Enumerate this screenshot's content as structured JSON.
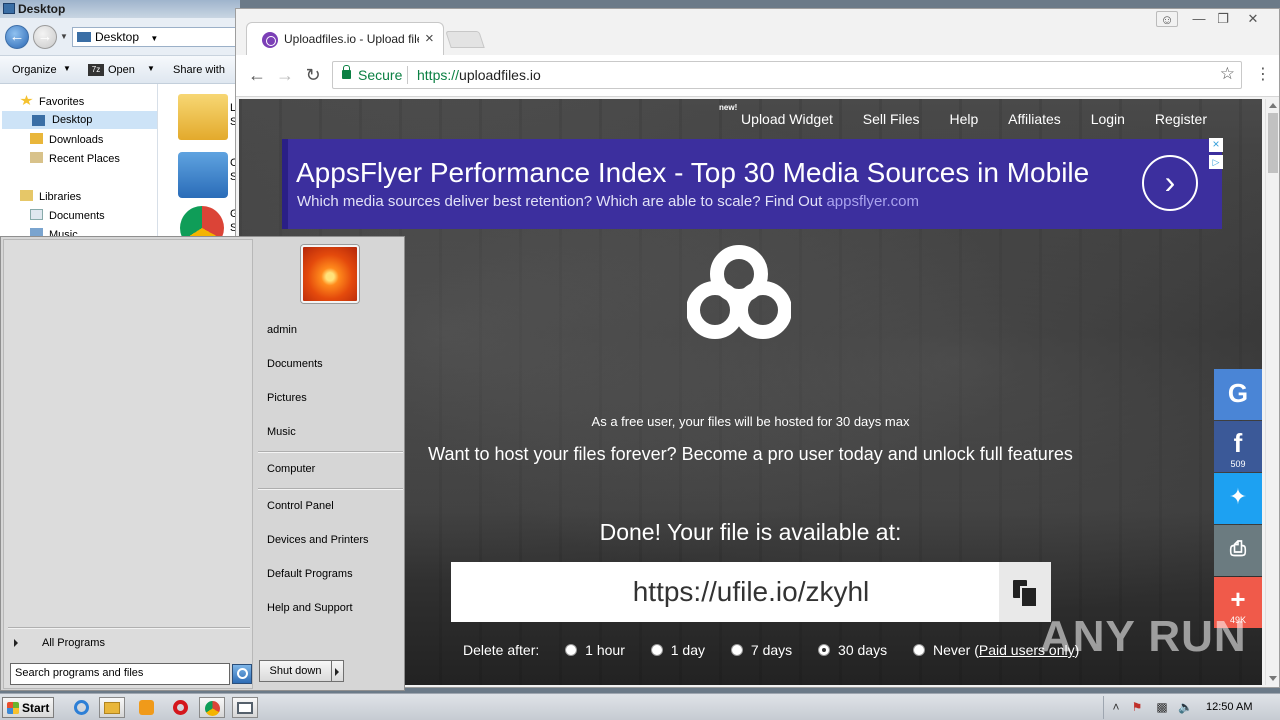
{
  "explorer": {
    "title": "Desktop",
    "address": "Desktop",
    "commands": [
      "Organize",
      "Open",
      "Share with"
    ],
    "nav": {
      "favorites": "Favorites",
      "desktop": "Desktop",
      "downloads": "Downloads",
      "recent": "Recent Places",
      "libraries": "Libraries",
      "documents": "Documents",
      "music": "Music"
    },
    "file_labels": [
      "L",
      "S",
      "C",
      "S",
      "G",
      "S"
    ]
  },
  "start_menu": {
    "links": [
      "admin",
      "Documents",
      "Pictures",
      "Music",
      "Computer",
      "Control Panel",
      "Devices and Printers",
      "Default Programs",
      "Help and Support"
    ],
    "all_programs": "All Programs",
    "search_placeholder": "Search programs and files",
    "shutdown": "Shut down"
  },
  "chrome": {
    "tab_title": "Uploadfiles.io - Upload files,",
    "secure": "Secure",
    "url_scheme": "https://",
    "url_host": "uploadfiles.io"
  },
  "page": {
    "nav": {
      "new_badge": "new!",
      "items": [
        "Upload Widget",
        "Sell Files",
        "Help",
        "Affiliates",
        "Login",
        "Register"
      ]
    },
    "ad": {
      "headline": "AppsFlyer Performance Index - Top 30 Media Sources in Mobile",
      "sub": "Which media sources deliver best retention? Which are able to scale? Find Out",
      "link": "appsflyer.com"
    },
    "free_note": "As a free user, your files will be hosted for 30 days max",
    "pro_note": "Want to host your files forever? Become a pro user today and unlock full features",
    "done": "Done! Your file is available at:",
    "file_link": "https://ufile.io/zkyhl",
    "delete_after_label": "Delete after:",
    "delete_options": [
      "1 hour",
      "1 day",
      "7 days",
      "30 days"
    ],
    "never_label": "Never (",
    "never_link": "Paid users only",
    "never_close": ")",
    "selected_option": "30 days",
    "social": {
      "facebook_count": "509",
      "more_count": "49K",
      "colors": {
        "google": "#4a85d6",
        "facebook": "#3b5998",
        "twitter": "#1da1f2",
        "print": "#6b7b80",
        "more": "#f05a4a"
      }
    }
  },
  "watermark": "ANY RUN",
  "taskbar": {
    "start": "Start",
    "clock": "12:50 AM"
  }
}
